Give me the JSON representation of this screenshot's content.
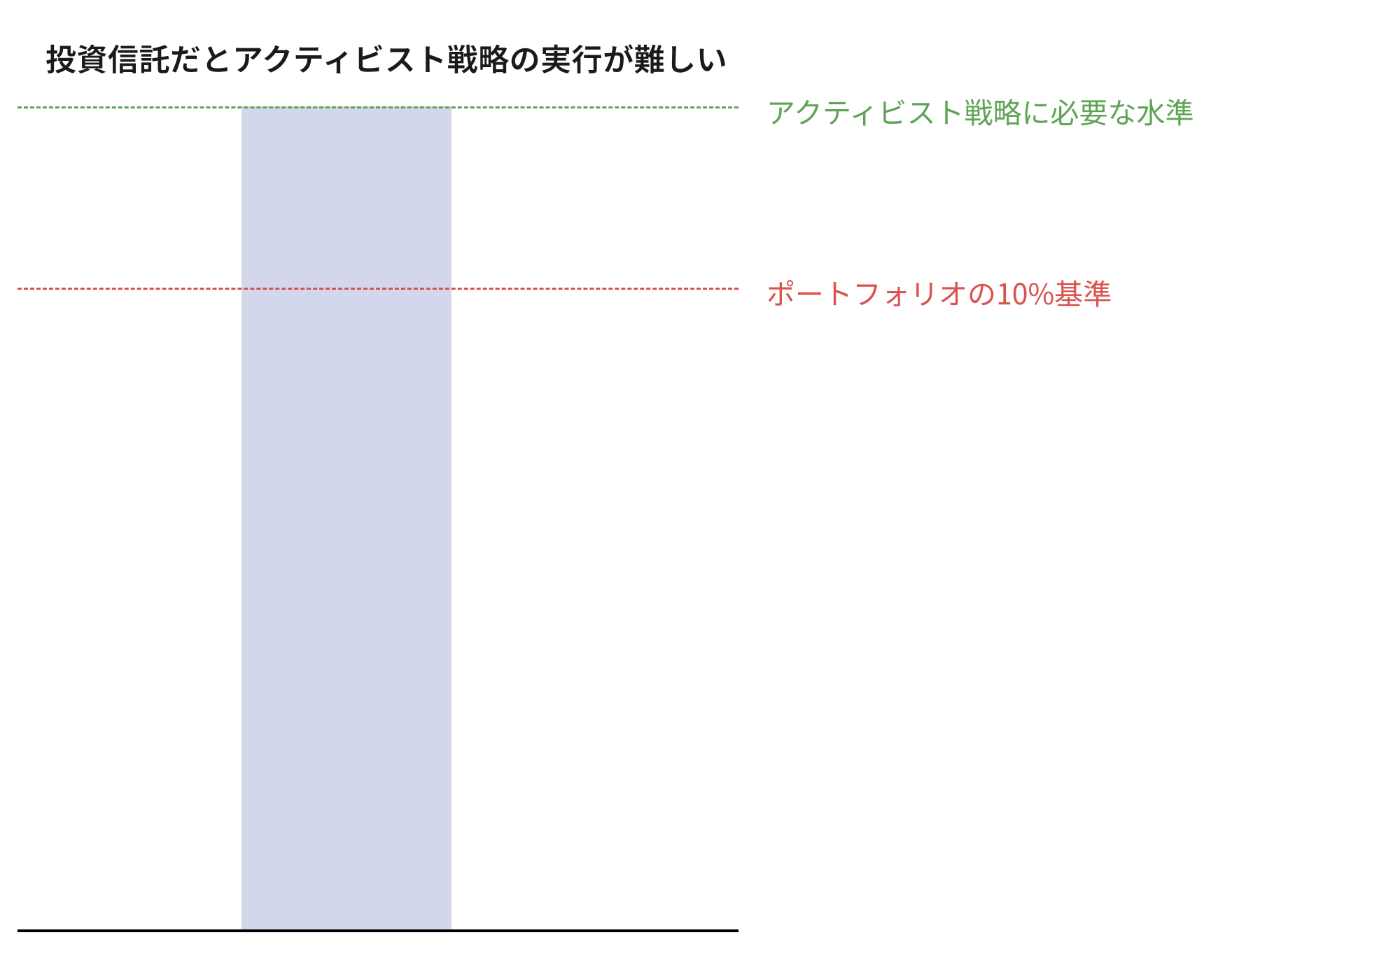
{
  "title": "投資信託だとアクティビスト戦略の実行が難しい",
  "reference_lines": {
    "activist": {
      "label": "アクティビスト戦略に必要な水準",
      "color": "#5fa456"
    },
    "portfolio": {
      "label": "ポートフォリオの10%基準",
      "color": "#d9534f"
    }
  },
  "chart_data": {
    "type": "bar",
    "categories": [
      ""
    ],
    "values": [
      100
    ],
    "title": "投資信託だとアクティビスト戦略の実行が難しい",
    "xlabel": "",
    "ylabel": "",
    "ylim": [
      0,
      100
    ],
    "bar_color": "#d2d7ec",
    "annotations": [
      {
        "type": "hline",
        "y": 100,
        "label": "アクティビスト戦略に必要な水準",
        "color": "#5fa456",
        "style": "dashed"
      },
      {
        "type": "hline",
        "y": 78,
        "label": "ポートフォリオの10%基準",
        "color": "#d9534f",
        "style": "dashed"
      }
    ]
  }
}
